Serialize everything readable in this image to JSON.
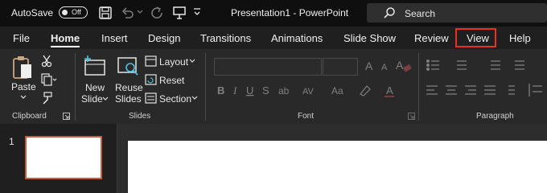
{
  "titlebar": {
    "autosave_label": "AutoSave",
    "autosave_state": "Off",
    "document_title": "Presentation1  -  PowerPoint",
    "search_placeholder": "Search"
  },
  "menu": {
    "tabs": [
      "File",
      "Home",
      "Insert",
      "Design",
      "Transitions",
      "Animations",
      "Slide Show",
      "Review",
      "View",
      "Help"
    ],
    "active_tab": "Home",
    "highlighted_tab": "View",
    "highlight_color": "#e8321e"
  },
  "ribbon": {
    "clipboard": {
      "paste_label": "Paste",
      "group_label": "Clipboard"
    },
    "slides": {
      "new_slide_line1": "New",
      "new_slide_line2": "Slide",
      "reuse_line1": "Reuse",
      "reuse_line2": "Slides",
      "layout_label": "Layout",
      "reset_label": "Reset",
      "section_label": "Section",
      "group_label": "Slides"
    },
    "font": {
      "group_label": "Font"
    },
    "paragraph": {
      "group_label": "Paragraph"
    }
  },
  "slide_pane": {
    "slide_number": "1",
    "thumbnail_border_color": "#c55b3b"
  }
}
